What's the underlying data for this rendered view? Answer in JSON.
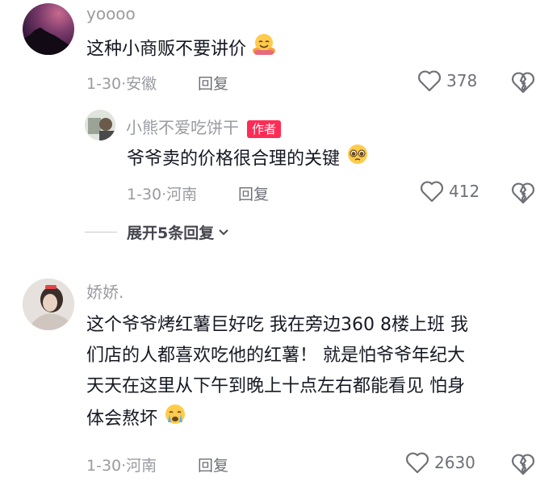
{
  "comments": [
    {
      "username": "yoooo",
      "text": "这种小商贩不要讲价",
      "date": "1-30",
      "location": "安徽",
      "reply_label": "回复",
      "likes": "378",
      "emoji": "hugging-face-emoji"
    },
    {
      "username": "小熊不爱吃饼干",
      "badge": "作者",
      "text": "爷爷卖的价格很合理的关键",
      "date": "1-30",
      "location": "河南",
      "reply_label": "回复",
      "likes": "412",
      "emoji": "pleading-face-emoji"
    },
    {
      "username": "娇娇.",
      "text_lines": [
        "这个爷爷烤红薯巨好吃 我在旁边360 8楼上班 我",
        "们店的人都喜欢吃他的红薯！ 就是怕爷爷年纪大",
        "天天在这里从下午到晚上十点左右都能看见 怕身",
        "体会熬坏"
      ],
      "date": "1-30",
      "location": "河南",
      "reply_label": "回复",
      "likes": "2630",
      "emoji": "crying-face-emoji"
    }
  ],
  "expand_replies": "展开5条回复",
  "meta_separator": "·",
  "colors": {
    "badge": "#fe2c55",
    "meta": "#9a9ba1",
    "text": "#161823"
  }
}
